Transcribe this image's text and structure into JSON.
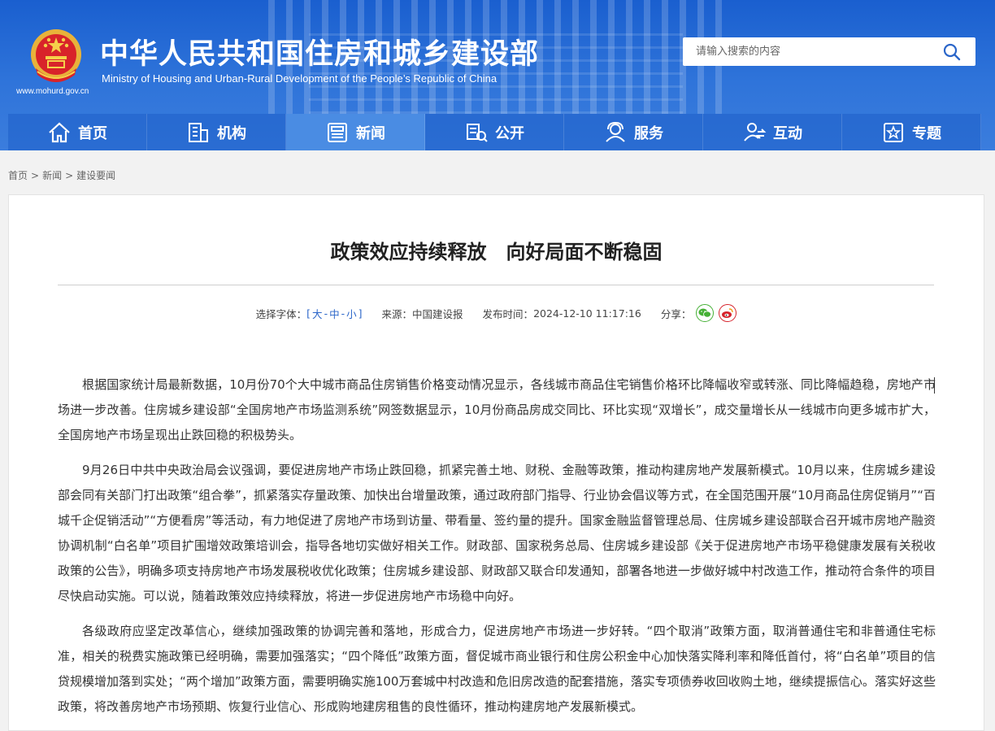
{
  "header": {
    "title_cn": "中华人民共和国住房和城乡建设部",
    "title_en": "Ministry of Housing and Urban-Rural Development of the People’s Republic of China",
    "site_url": "www.mohurd.gov.cn",
    "search": {
      "placeholder": "请输入搜索的内容",
      "icon": "search-icon"
    }
  },
  "nav": {
    "items": [
      {
        "label": "首页",
        "icon": "home-icon"
      },
      {
        "label": "机构",
        "icon": "building-icon"
      },
      {
        "label": "新闻",
        "icon": "news-icon",
        "active": true
      },
      {
        "label": "公开",
        "icon": "open-icon"
      },
      {
        "label": "服务",
        "icon": "service-icon"
      },
      {
        "label": "互动",
        "icon": "interaction-icon"
      },
      {
        "label": "专题",
        "icon": "topic-icon"
      }
    ]
  },
  "breadcrumb": [
    "首页",
    "新闻",
    "建设要闻"
  ],
  "article": {
    "title": "政策效应持续释放　向好局面不断稳固",
    "meta": {
      "font_size_label": "选择字体：",
      "font_sizes": [
        "大",
        "中",
        "小"
      ],
      "source_label": "来源：",
      "source": "中国建设报",
      "time_label": "发布时间：",
      "time": "2024-12-10 11:17:16",
      "share_label": "分享："
    },
    "paragraphs": [
      "根据国家统计局最新数据，10月份70个大中城市商品住房销售价格变动情况显示，各线城市商品住宅销售价格环比降幅收窄或转涨、同比降幅趋稳，房地产市场进一步改善。住房城乡建设部“全国房地产市场监测系统”网签数据显示，10月份商品房成交同比、环比实现“双增长”，成交量增长从一线城市向更多城市扩大，全国房地产市场呈现出止跌回稳的积极势头。",
      "9月26日中共中央政治局会议强调，要促进房地产市场止跌回稳，抓紧完善土地、财税、金融等政策，推动构建房地产发展新模式。10月以来，住房城乡建设部会同有关部门打出政策“组合拳”，抓紧落实存量政策、加快出台增量政策，通过政府部门指导、行业协会倡议等方式，在全国范围开展“10月商品住房促销月”“百城千企促销活动”“方便看房”等活动，有力地促进了房地产市场到访量、带看量、签约量的提升。国家金融监督管理总局、住房城乡建设部联合召开城市房地产融资协调机制“白名单”项目扩围增效政策培训会，指导各地切实做好相关工作。财政部、国家税务总局、住房城乡建设部《关于促进房地产市场平稳健康发展有关税收政策的公告》，明确多项支持房地产市场发展税收优化政策；住房城乡建设部、财政部又联合印发通知，部署各地进一步做好城中村改造工作，推动符合条件的项目尽快启动实施。可以说，随着政策效应持续释放，将进一步促进房地产市场稳中向好。",
      "各级政府应坚定改革信心，继续加强政策的协调完善和落地，形成合力，促进房地产市场进一步好转。“四个取消”政策方面，取消普通住宅和非普通住宅标准，相关的税费实施政策已经明确，需要加强落实；“四个降低”政策方面，督促城市商业银行和住房公积金中心加快落实降利率和降低首付，将“白名单”项目的信贷规模增加落到实处；“两个增加”政策方面，需要明确实施100万套城中村改造和危旧房改造的配套措施，落实专项债券收回收购土地，继续提振信心。落实好这些政策，将改善房地产市场预期、恢复行业信心、形成购地建房租售的良性循环，推动构建房地产发展新模式。"
    ]
  },
  "colors": {
    "header_blue": "#2f74da",
    "nav_active": "#4a8ce3",
    "link_blue": "#2b66c9"
  }
}
